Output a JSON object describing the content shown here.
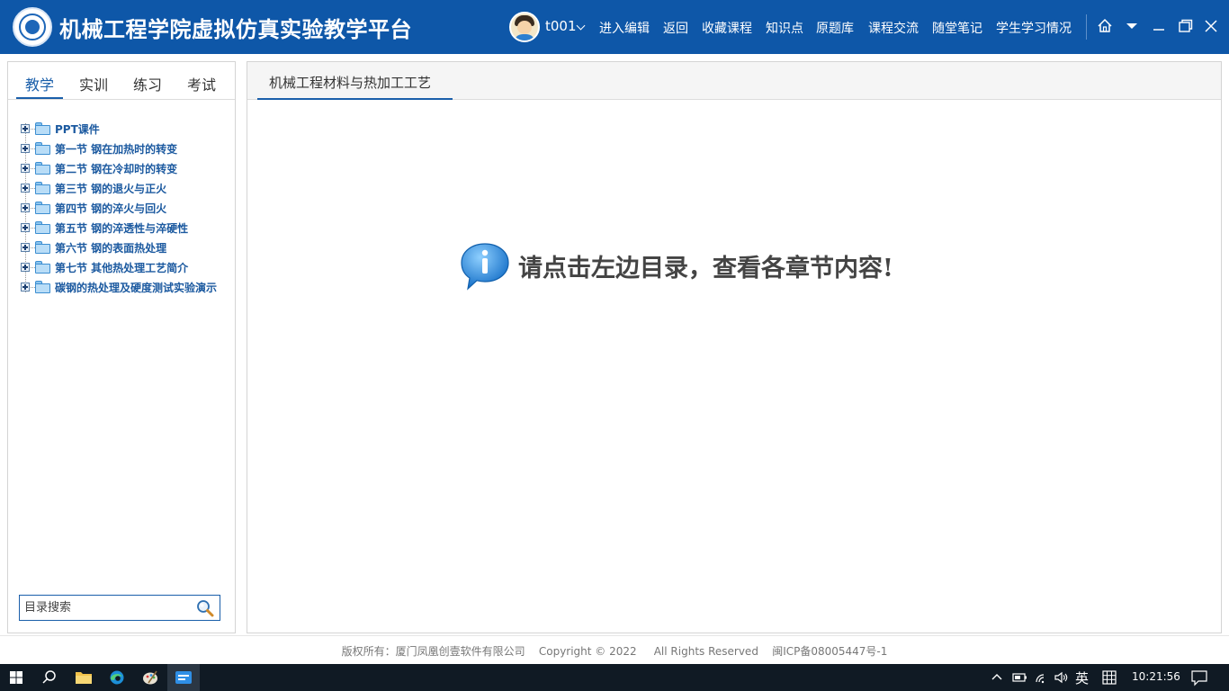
{
  "header": {
    "title": "机械工程学院虚拟仿真实验教学平台",
    "user": {
      "name": "t001"
    },
    "nav": [
      "进入编辑",
      "返回",
      "收藏课程",
      "知识点",
      "原题库",
      "课程交流",
      "随堂笔记",
      "学生学习情况"
    ],
    "icons": [
      "home-icon",
      "dropdown-icon",
      "minimize-icon",
      "maximize-icon",
      "close-icon"
    ]
  },
  "sidebar": {
    "tabs": [
      {
        "label": "教学",
        "active": true
      },
      {
        "label": "实训",
        "active": false
      },
      {
        "label": "练习",
        "active": false
      },
      {
        "label": "考试",
        "active": false
      }
    ],
    "tree": [
      "PPT课件",
      "第一节  钢在加热时的转变",
      "第二节  钢在冷却时的转变",
      "第三节  钢的退火与正火",
      "第四节  钢的淬火与回火",
      "第五节  钢的淬透性与淬硬性",
      "第六节  钢的表面热处理",
      "第七节  其他热处理工艺简介",
      "碳钢的热处理及硬度测试实验演示"
    ],
    "search": {
      "placeholder": "目录搜索",
      "value": ""
    }
  },
  "main": {
    "tab": "机械工程材料与热加工工艺",
    "message": "请点击左边目录，查看各章节内容!"
  },
  "footer": {
    "text": "版权所有：厦门凤凰创壹软件有限公司    Copyright © 2022     All Rights Reserved    闽ICP备08005447号-1"
  },
  "taskbar": {
    "clock": "10:21:56",
    "ime": "英"
  },
  "colors": {
    "header_bg": "#0e57a8",
    "accent": "#1a5faa",
    "tree_text": "#1c5aa0",
    "taskbar_bg": "#101a24"
  }
}
